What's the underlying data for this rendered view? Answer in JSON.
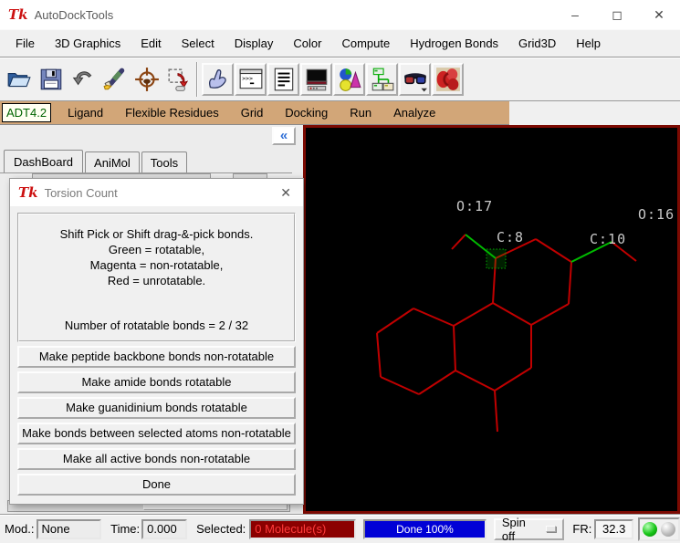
{
  "window": {
    "title": "AutoDockTools",
    "controls": {
      "minimize": "–",
      "maximize": "◻",
      "close": "✕"
    }
  },
  "menubar": {
    "items": [
      "File",
      "3D Graphics",
      "Edit",
      "Select",
      "Display",
      "Color",
      "Compute",
      "Hydrogen Bonds",
      "Grid3D",
      "Help"
    ]
  },
  "toolbar": {
    "icon_names": [
      "open-file-icon",
      "save-icon",
      "undo-icon",
      "edit-marker-icon",
      "center-target-icon",
      "rubber-band-pick-icon",
      "pick-hand-icon",
      "python-shell-icon",
      "output-text-icon",
      "display-device-icon",
      "geometry-shapes-icon",
      "dashboard-tree-icon",
      "stereo-glasses-icon",
      "adt-molecule-icon"
    ]
  },
  "mode_tabs": {
    "items": [
      {
        "label": "ADT4.2",
        "active": true
      },
      {
        "label": "Ligand",
        "active": false
      },
      {
        "label": "Flexible Residues",
        "active": false
      },
      {
        "label": "Grid",
        "active": false
      },
      {
        "label": "Docking",
        "active": false
      },
      {
        "label": "Run",
        "active": false
      },
      {
        "label": "Analyze",
        "active": false
      }
    ]
  },
  "panel_tabs": {
    "items": [
      "DashBoard",
      "AniMol",
      "Tools"
    ],
    "active": "DashBoard",
    "collapse_glyph": "«"
  },
  "dialog": {
    "title": "Torsion Count",
    "close_glyph": "✕",
    "message_lines": [
      "Shift Pick or Shift drag-&-pick bonds.",
      "Green = rotatable,",
      "Magenta = non-rotatable,",
      "Red = unrotatable."
    ],
    "count_line": "Number of rotatable bonds = 2 / 32",
    "buttons": [
      "Make peptide backbone bonds non-rotatable",
      "Make amide bonds rotatable",
      "Make guanidinium bonds rotatable",
      "Make bonds between selected atoms non-rotatable",
      "Make all active bonds non-rotatable",
      "Done"
    ]
  },
  "viewer": {
    "atom_labels": [
      "O:17",
      "C:8",
      "C:10",
      "O:16"
    ],
    "rotatable_bond_count": "2 / 32",
    "bond_colors": {
      "rotatable": "#00bb00",
      "unrotatable": "#c00000"
    }
  },
  "statusbar": {
    "mod_label": "Mod.:",
    "mod_value": "None",
    "time_label": "Time:",
    "time_value": "0.000",
    "selected_label": "Selected:",
    "selected_value": "0 Molecule(s)",
    "progress_text": "Done 100%",
    "spin_label": "Spin off",
    "fr_label": "FR:",
    "fr_value": "32.3",
    "leds": {
      "left": "green-on",
      "right": "gray-off"
    }
  },
  "colors": {
    "tan_bar": "#d2a678",
    "adt_tab_text": "#006400",
    "viewer_border": "#7c0a02",
    "selected_bg": "#8b0000",
    "selected_text": "#ff3a3a",
    "progress_bg": "#0000d6",
    "bond_red": "#c00000",
    "bond_green": "#00bb00",
    "label_gray": "#d9d9d9"
  }
}
